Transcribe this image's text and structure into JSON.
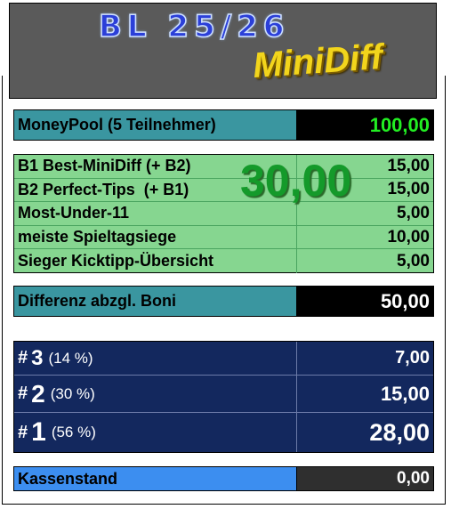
{
  "header": {
    "title": "BL 25/26",
    "subtitle": "MiniDiff"
  },
  "moneypool": {
    "label": "MoneyPool (5 Teilnehmer)",
    "value": "100,00",
    "value_color": "#22ee22"
  },
  "bonus_overlay": "30,00",
  "bonuses": [
    {
      "label": "B1 Best-MiniDiff (+ B2)",
      "value": "15,00"
    },
    {
      "label": "B2 Perfect-Tips  (+ B1)",
      "value": "15,00"
    },
    {
      "label": "Most-Under-11",
      "value": "5,00"
    },
    {
      "label": "meiste Spieltagsiege",
      "value": "10,00"
    },
    {
      "label": "Sieger Kicktipp-Übersicht",
      "value": "5,00"
    }
  ],
  "difference": {
    "label": "Differenz abzgl. Boni",
    "value": "50,00"
  },
  "prizes": [
    {
      "hash": "#",
      "rank": "3",
      "percent": "(14 %)",
      "value": "7,00"
    },
    {
      "hash": "#",
      "rank": "2",
      "percent": "(30 %)",
      "value": "15,00"
    },
    {
      "hash": "#",
      "rank": "1",
      "percent": "(56 %)",
      "value": "28,00"
    }
  ],
  "kassenstand": {
    "label": "Kassenstand",
    "value": "0,00"
  }
}
